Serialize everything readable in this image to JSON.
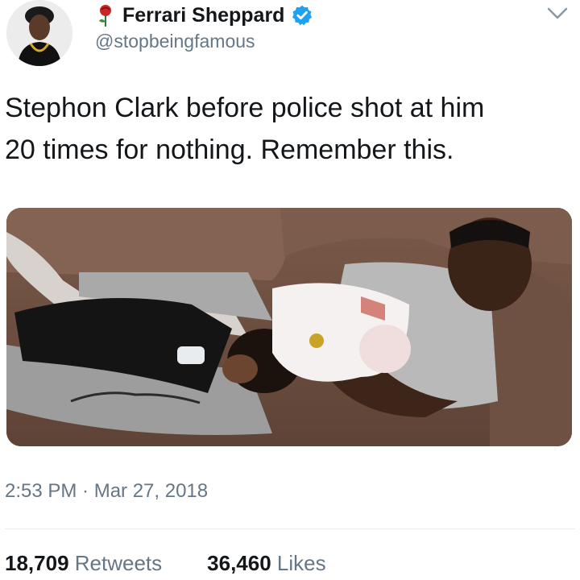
{
  "author": {
    "display_name": "Ferrari Sheppard",
    "handle": "@stopbeingfamous",
    "verified": true,
    "avatar_icon": "profile-avatar",
    "emoji_icon": "rose-icon",
    "verified_icon": "verified-badge-icon",
    "menu_icon": "chevron-down-icon"
  },
  "tweet": {
    "text_line1": "Stephon Clark before police shot at him",
    "text_line2": "20 times for nothing.  Remember this."
  },
  "photo": {
    "icon": "photo-image"
  },
  "meta": {
    "timestamp": "2:53 PM · Mar 27, 2018"
  },
  "stats": {
    "retweets_count": "18,709",
    "retweets_label": "Retweets",
    "likes_count": "36,460",
    "likes_label": "Likes"
  },
  "colors": {
    "text": "#14171a",
    "secondary": "#657786",
    "verified_blue": "#1da1f2",
    "divider": "#e6ecf0"
  }
}
